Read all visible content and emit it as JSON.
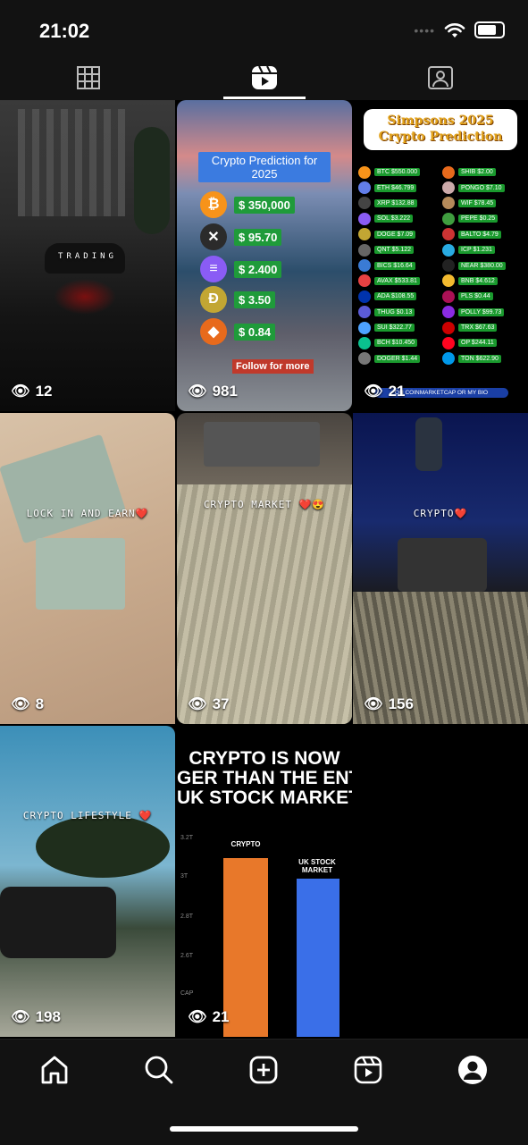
{
  "status_bar": {
    "time": "21:02"
  },
  "profile_tabs": [
    {
      "name": "posts-grid",
      "icon": "grid-icon"
    },
    {
      "name": "reels",
      "icon": "reels-icon",
      "active": true
    },
    {
      "name": "tagged",
      "icon": "tagged-user-icon"
    }
  ],
  "reels": [
    {
      "views": "12",
      "caption": "TRADING"
    },
    {
      "views": "981",
      "caption": "Crypto Prediction for 2025",
      "rows": [
        {
          "coin": "bitcoin",
          "price": "$ 350,000",
          "color": "#f7931a",
          "glyph": "₿"
        },
        {
          "coin": "xrp",
          "price": "$ 95.70",
          "color": "#2b2b2b",
          "glyph": "✕"
        },
        {
          "coin": "solana",
          "price": "$ 2.400",
          "color": "#8a5cf5",
          "glyph": "≡"
        },
        {
          "coin": "dogecoin",
          "price": "$ 3.50",
          "color": "#c2a633",
          "glyph": "Ð"
        },
        {
          "coin": "shiba",
          "price": "$ 0.84",
          "color": "#e86a1c",
          "glyph": "◆"
        }
      ],
      "follow": "Follow for more"
    },
    {
      "views": "21",
      "title_line1": "Simpsons 2025",
      "title_line2": "Crypto Prediction",
      "left": [
        "BTC $550.000",
        "ETH $46.799",
        "XRP $132.88",
        "SOL $3.222",
        "DOGE $7.09",
        "QNT $5.122",
        "BICS $16.64",
        "AVAX $533.81",
        "ADA $108.55",
        "THUG $0.13",
        "SUI $322.77",
        "BCH $10.450",
        "DOGER $1.44"
      ],
      "right": [
        "SHIB $2.00",
        "PONGO $7.10",
        "WIF $78.45",
        "PEPE $0.25",
        "BALTO $4.79",
        "ICP $1.231",
        "NEAR $380.00",
        "BNB $4.612",
        "PLS $0.44",
        "POLLY $99.73",
        "TRX $67.63",
        "OP $244.11",
        "TON $622.90"
      ],
      "footer": "ON COINMARKETCAP OR MY BIO"
    },
    {
      "views": "8",
      "caption": "LOCK IN AND EARN❤️"
    },
    {
      "views": "37",
      "caption": "CRYPTO MARKET ❤️😍"
    },
    {
      "views": "156",
      "caption": "CRYPTO❤️"
    },
    {
      "views": "198",
      "caption": "CRYPTO LIFESTYLE ❤️"
    },
    {
      "views": "21",
      "headline": [
        "CRYPTO IS NOW",
        "GER THAN THE ENT",
        "UK STOCK MARKET"
      ],
      "bar_labels": [
        "CRYPTO",
        "UK STOCK MARKET"
      ],
      "ticks": [
        "3.2T",
        "3T",
        "2.8T",
        "2.6T",
        "CAP"
      ]
    }
  ],
  "bottom_nav": [
    {
      "name": "home",
      "icon": "home-icon"
    },
    {
      "name": "search",
      "icon": "search-icon"
    },
    {
      "name": "create",
      "icon": "plus-square-icon"
    },
    {
      "name": "reels",
      "icon": "reels-icon"
    },
    {
      "name": "profile",
      "icon": "profile-icon"
    }
  ]
}
